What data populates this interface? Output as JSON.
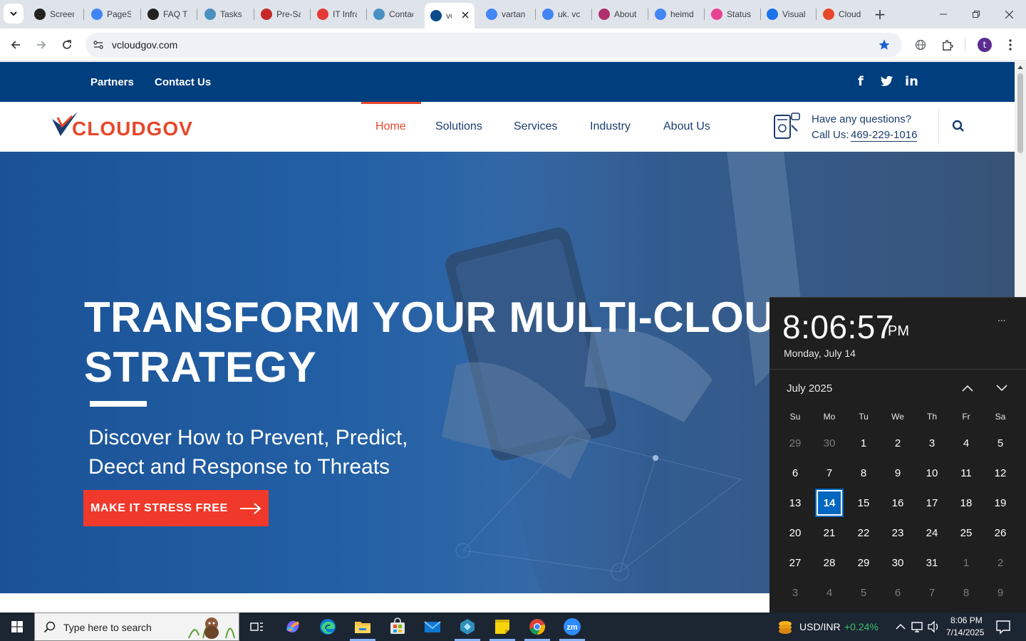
{
  "browser": {
    "tabs": [
      {
        "label": "Screen",
        "icon": "screencast-icon",
        "color": "#222222"
      },
      {
        "label": "PageSpeed",
        "icon": "pagespeed-icon",
        "color": "#4285f4"
      },
      {
        "label": "FAQ T",
        "icon": "chatgpt-icon",
        "color": "#222222"
      },
      {
        "label": "Tasks",
        "icon": "hexagon-app-icon",
        "color": "#4a90c2"
      },
      {
        "label": "Pre-Sales",
        "icon": "v-logo-icon",
        "color": "#c62828"
      },
      {
        "label": "IT Infra",
        "icon": "diamond-app-icon",
        "color": "#e53935"
      },
      {
        "label": "Contacts",
        "icon": "hexagon-app-icon",
        "color": "#4a90c2"
      },
      {
        "label": "vc",
        "icon": "cloudgov-favicon-icon",
        "color": "#0b4a8b"
      },
      {
        "label": "vartan",
        "icon": "google-icon",
        "color": "#4285f4"
      },
      {
        "label": "uk. vc",
        "icon": "google-icon",
        "color": "#4285f4"
      },
      {
        "label": "About",
        "icon": "app-pink-icon",
        "color": "#b0306e"
      },
      {
        "label": "heimd",
        "icon": "google-icon",
        "color": "#4285f4"
      },
      {
        "label": "Status",
        "icon": "feather-icon",
        "color": "#e84393"
      },
      {
        "label": "Visual",
        "icon": "pulse-icon",
        "color": "#1a73e8"
      },
      {
        "label": "Cloud",
        "icon": "cloud-app-icon",
        "color": "#e8472a"
      }
    ],
    "url": "vcloudgov.com",
    "profile_initial": "t",
    "profile_color": "#5b2d90"
  },
  "site": {
    "top_links": [
      "Partners",
      "Contact Us"
    ],
    "social": [
      "f",
      "t",
      "in"
    ],
    "logo_text": "CLOUDGOV",
    "nav": [
      {
        "label": "Home",
        "active": true
      },
      {
        "label": "Solutions",
        "active": false
      },
      {
        "label": "Services",
        "active": false
      },
      {
        "label": "Industry",
        "active": false
      },
      {
        "label": "About Us",
        "active": false
      }
    ],
    "contact_line1": "Have any questions?",
    "contact_line2_prefix": "Call Us: ",
    "contact_phone": "469-229-1016",
    "hero_title_line1": "TRANSFORM YOUR MULTI-CLOUD",
    "hero_title_line2": "STRATEGY",
    "hero_sub_line1": "Discover How to Prevent, Predict,",
    "hero_sub_line2": "Deect and Response to Threats",
    "cta_label": "MAKE IT STRESS FREE",
    "brand_blue": "#003e7e",
    "accent_red": "#e8472a"
  },
  "calendar": {
    "time": "8:06:57",
    "ampm": "PM",
    "full_date": "Monday, July 14",
    "month_label": "July 2025",
    "more": "...",
    "weekdays": [
      "Su",
      "Mo",
      "Tu",
      "We",
      "Th",
      "Fr",
      "Sa"
    ],
    "weeks": [
      [
        {
          "d": "29",
          "o": true
        },
        {
          "d": "30",
          "o": true
        },
        {
          "d": "1"
        },
        {
          "d": "2"
        },
        {
          "d": "3"
        },
        {
          "d": "4"
        },
        {
          "d": "5"
        }
      ],
      [
        {
          "d": "6"
        },
        {
          "d": "7"
        },
        {
          "d": "8"
        },
        {
          "d": "9"
        },
        {
          "d": "10"
        },
        {
          "d": "11"
        },
        {
          "d": "12"
        }
      ],
      [
        {
          "d": "13"
        },
        {
          "d": "14",
          "today": true
        },
        {
          "d": "15"
        },
        {
          "d": "16"
        },
        {
          "d": "17"
        },
        {
          "d": "18"
        },
        {
          "d": "19"
        }
      ],
      [
        {
          "d": "20"
        },
        {
          "d": "21"
        },
        {
          "d": "22"
        },
        {
          "d": "23"
        },
        {
          "d": "24"
        },
        {
          "d": "25"
        },
        {
          "d": "26"
        }
      ],
      [
        {
          "d": "27"
        },
        {
          "d": "28"
        },
        {
          "d": "29"
        },
        {
          "d": "30"
        },
        {
          "d": "31"
        },
        {
          "d": "1",
          "o": true
        },
        {
          "d": "2",
          "o": true
        }
      ],
      [
        {
          "d": "3",
          "o": true
        },
        {
          "d": "4",
          "o": true
        },
        {
          "d": "5",
          "o": true
        },
        {
          "d": "6",
          "o": true
        },
        {
          "d": "7",
          "o": true
        },
        {
          "d": "8",
          "o": true
        },
        {
          "d": "9",
          "o": true
        }
      ]
    ]
  },
  "taskbar": {
    "search_placeholder": "Type here to search",
    "ticker_label": "USD/INR",
    "ticker_change": "+0.24%",
    "clock_time": "8:06 PM",
    "clock_date": "7/14/2025"
  }
}
